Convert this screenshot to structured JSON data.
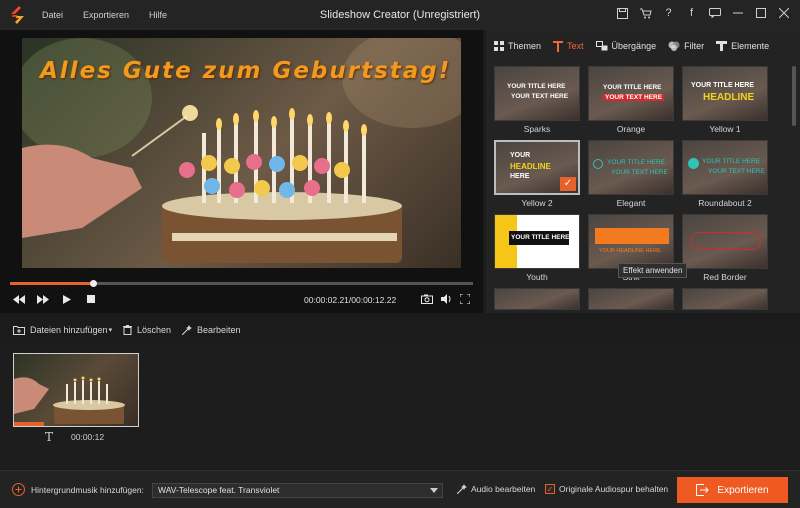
{
  "app": {
    "title": "Slideshow Creator (Unregistriert)",
    "menu": [
      "Datei",
      "Exportieren",
      "Hilfe"
    ]
  },
  "colors": {
    "accent": "#ee5a22",
    "title_text": "#f29a1f"
  },
  "preview": {
    "video_title": "Alles Gute zum Geburtstag!",
    "time_current": "00:00:02.21",
    "time_total": "00:00:12.22",
    "time_display": "00:00:02.21/00:00:12.22",
    "progress": 0.18
  },
  "side": {
    "tabs": [
      {
        "label": "Themen",
        "icon": "grid-icon"
      },
      {
        "label": "Text",
        "icon": "text-icon"
      },
      {
        "label": "Übergänge",
        "icon": "transition-icon"
      },
      {
        "label": "Filter",
        "icon": "filter-icon"
      },
      {
        "label": "Elemente",
        "icon": "element-icon"
      }
    ],
    "active_tab": "Text",
    "tiles": [
      {
        "label": "Sparks",
        "l1": "YOUR TITLE HERE",
        "l2": "YOUR TEXT HERE"
      },
      {
        "label": "Orange",
        "l1": "YOUR TITLE HERE",
        "l2": "YOUR TEXT HERE"
      },
      {
        "label": "Yellow 1",
        "l1": "YOUR TITLE HERE",
        "l2": "HEADLINE"
      },
      {
        "label": "Yellow 2",
        "l1": "YOUR",
        "l2": "HEADLINE",
        "l3": "HERE"
      },
      {
        "label": "Elegant",
        "l1": "YOUR TITLE HERE",
        "l2": "YOUR TEXT HERE"
      },
      {
        "label": "Roundabout 2",
        "l1": "YOUR TITLE HERE",
        "l2": "YOUR TEXT HERE"
      },
      {
        "label": "Youth",
        "l1": "YOUR TITLE HERE",
        "l2": ""
      },
      {
        "label": "Strik",
        "l1": "",
        "l2": "YOUR HEADLINE HERE"
      },
      {
        "label": "Red Border",
        "l1": "",
        "l2": ""
      }
    ],
    "tooltip": "Effekt anwenden"
  },
  "toolbar": {
    "add_files": "Dateien hinzufügen",
    "delete": "Löschen",
    "edit": "Bearbeiten"
  },
  "storyboard": {
    "clip_duration": "00:00:12",
    "clip_text_icon": "T"
  },
  "bottom": {
    "add_music": "Hintergrundmusik hinzufügen:",
    "music_value": "WAV-Telescope feat. Transviolet",
    "edit_audio": "Audio bearbeiten",
    "keep_original": "Originale Audiospur behalten",
    "keep_original_checked": true,
    "export": "Exportieren"
  }
}
